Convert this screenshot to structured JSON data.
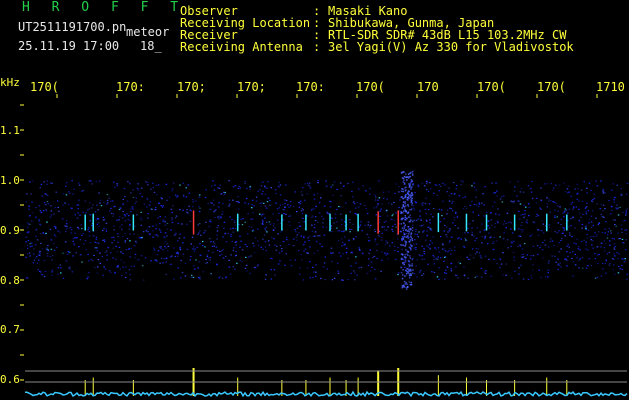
{
  "header": {
    "app_title": "H R O F F T",
    "filename": "UT2511191700.pn",
    "filename_suffix": "meteor",
    "datetime": "25.11.19 17:00",
    "datetime_suffix": "18_",
    "fields": [
      {
        "label": "Observer",
        "value": "Masaki Kano"
      },
      {
        "label": "Receiving Location",
        "value": "Shibukawa, Gunma, Japan"
      },
      {
        "label": "Receiver",
        "value": "RTL-SDR SDR# 43dB L15 103.2MHz CW"
      },
      {
        "label": "Receiving Antenna",
        "value": "3el Yagi(V) Az 330 for Vladivostok"
      }
    ],
    "colon": ":"
  },
  "x_axis": {
    "ticks": [
      "170(",
      "170:",
      "170;",
      "170;",
      "170:",
      "170(",
      "170",
      "170(",
      "170(",
      "1710"
    ]
  },
  "y_axis": {
    "unit": "kHz",
    "ticks": [
      "1.1",
      "1.0",
      "0.9",
      "0.8",
      "0.7",
      "0.6"
    ]
  },
  "colors": {
    "text_yellow": "#ffff3a",
    "title_green": "#22d04a",
    "noise_blue": "#1a2cff",
    "echo_cyan": "#35e8ff",
    "echo_red": "#ff3a3a",
    "trace_cyan": "#39c8ff",
    "trace_yellow": "#ffff3a"
  },
  "echoes": [
    {
      "minute": 1.5,
      "strength": 0.5
    },
    {
      "minute": 1.7,
      "strength": 0.6
    },
    {
      "minute": 2.7,
      "strength": 0.5
    },
    {
      "minute": 4.2,
      "strength": 1.0
    },
    {
      "minute": 5.3,
      "strength": 0.6
    },
    {
      "minute": 6.4,
      "strength": 0.5
    },
    {
      "minute": 7.0,
      "strength": 0.5
    },
    {
      "minute": 7.6,
      "strength": 0.6
    },
    {
      "minute": 8.0,
      "strength": 0.5
    },
    {
      "minute": 8.3,
      "strength": 0.6
    },
    {
      "minute": 8.8,
      "strength": 0.9
    },
    {
      "minute": 9.3,
      "strength": 1.0
    },
    {
      "minute": 10.3,
      "strength": 0.7
    },
    {
      "minute": 11.0,
      "strength": 0.6
    },
    {
      "minute": 11.5,
      "strength": 0.5
    },
    {
      "minute": 12.2,
      "strength": 0.5
    },
    {
      "minute": 13.0,
      "strength": 0.6
    },
    {
      "minute": 13.5,
      "strength": 0.5
    }
  ]
}
